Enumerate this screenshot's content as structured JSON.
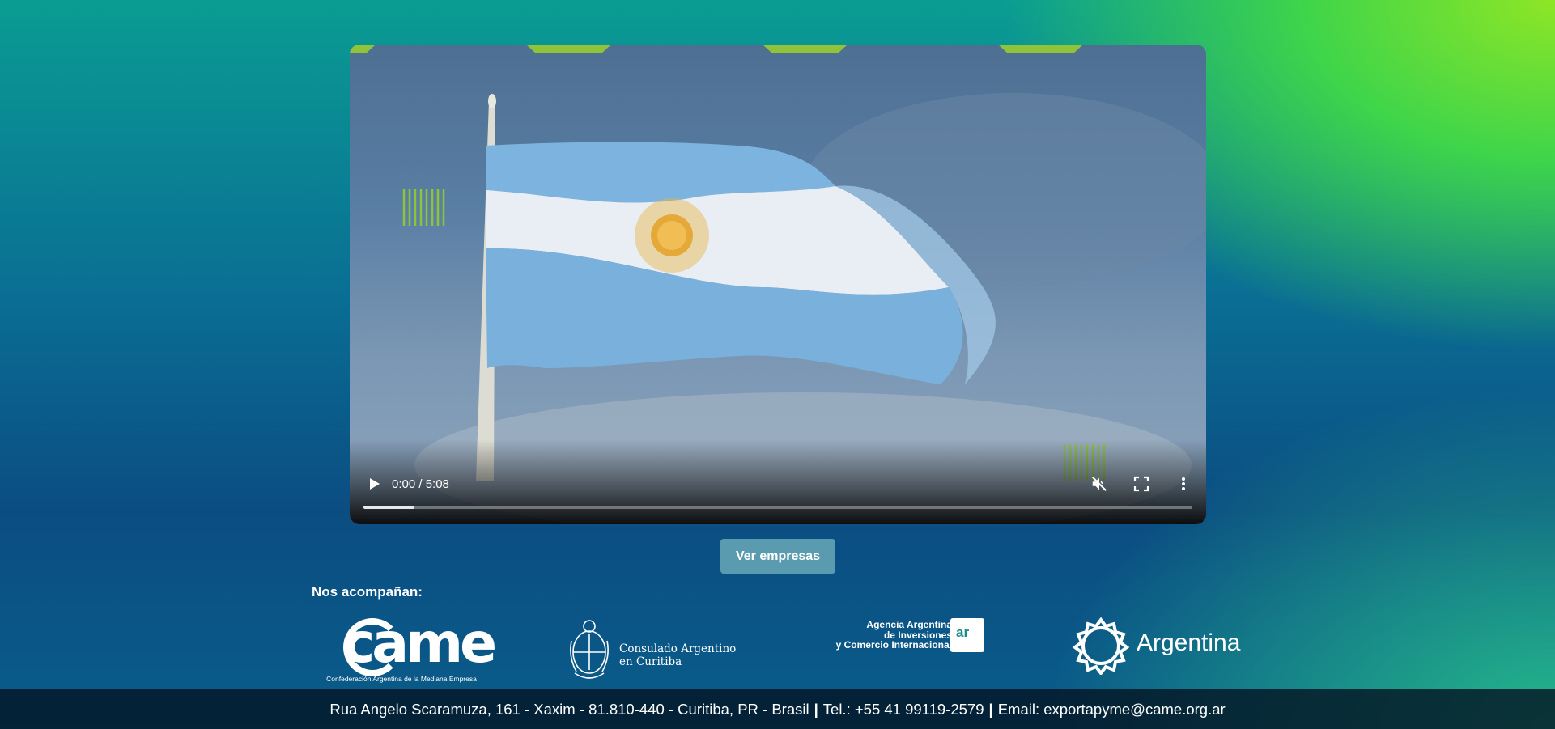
{
  "video": {
    "time_display": "0:00 / 5:08",
    "progress_buffered_fraction": 0.062,
    "muted": true,
    "icons": [
      "play-icon",
      "volume-muted-icon",
      "fullscreen-icon",
      "more-options-icon"
    ]
  },
  "button": {
    "label": "Ver empresas"
  },
  "sponsors": {
    "heading": "Nos acompañan:",
    "came": {
      "wordmark": "came",
      "subtitle": "Confederación Argentina de la Mediana Empresa"
    },
    "consulado": {
      "line1": "Consulado Argentino",
      "line2": "en Curitiba"
    },
    "agencia": {
      "line1": "Agencia Argentina",
      "line2": "de Inversiones",
      "line3": "y Comercio Internacional",
      "badge": "ar"
    },
    "argentina": {
      "wordmark": "Argentina"
    }
  },
  "footer": {
    "address": "Rua Angelo Scaramuza, 161 - Xaxim - 81.810-440 - Curitiba, PR - Brasil",
    "separator": "|",
    "phone": "Tel.: +55 41 99119-2579",
    "email": "Email: exportapyme@came.org.ar"
  },
  "colors": {
    "accent_green": "#8fc43a",
    "button_bg": "#5a9bb0",
    "footer_bg": "#04161e"
  }
}
